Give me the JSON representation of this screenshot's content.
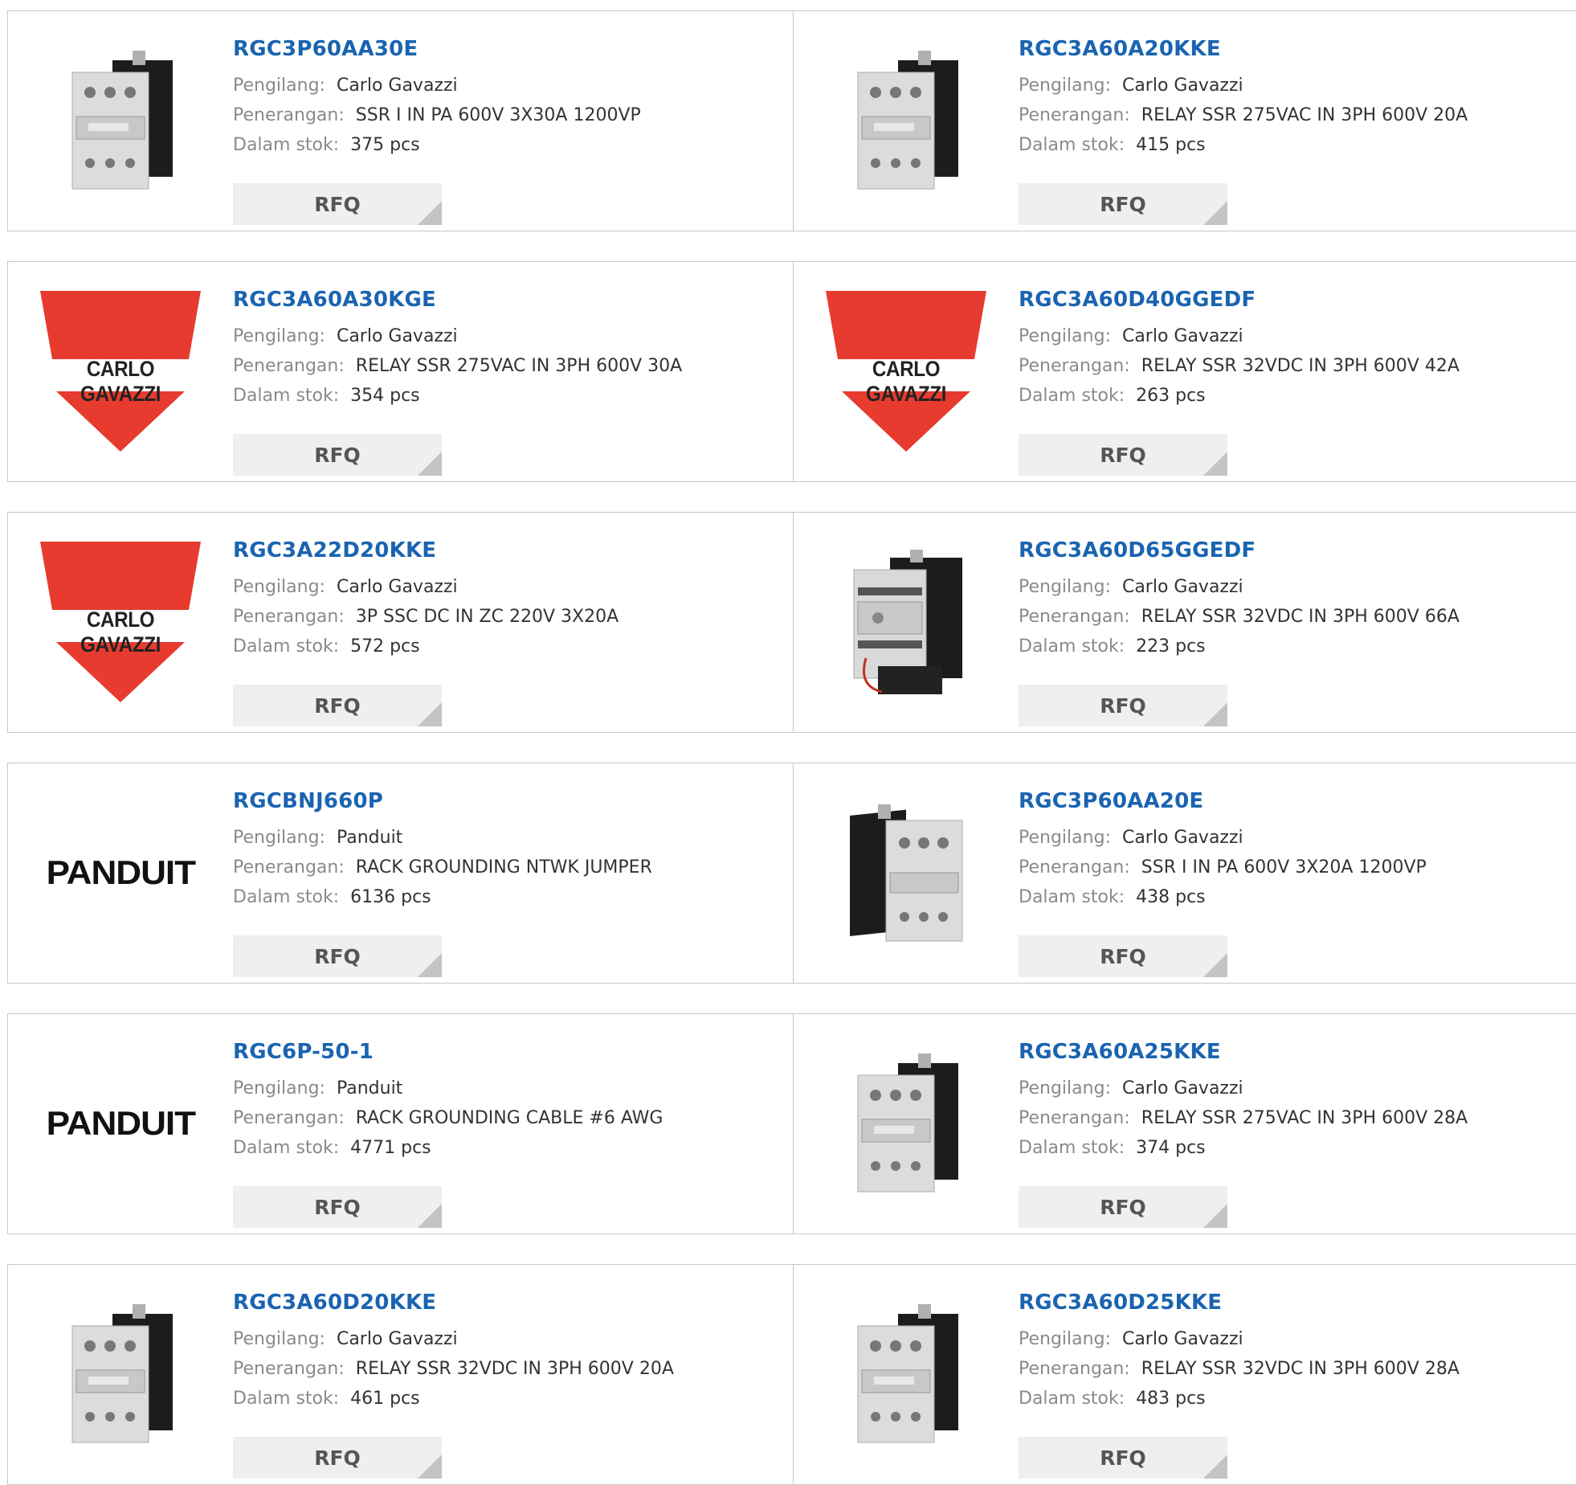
{
  "labels": {
    "manufacturer": "Pengilang:",
    "description": "Penerangan:",
    "stock": "Dalam stok:",
    "rfq": "RFQ"
  },
  "brand_logos": {
    "carlo": "CARLO GAVAZZI",
    "panduit": "PANDUIT"
  },
  "products": [
    {
      "part": "RGC3P60AA30E",
      "manufacturer": "Carlo Gavazzi",
      "description": "SSR I IN PA 600V 3X30A 1200VP",
      "stock": "375 pcs",
      "image": "relay-photo"
    },
    {
      "part": "RGC3A60A20KKE",
      "manufacturer": "Carlo Gavazzi",
      "description": "RELAY SSR 275VAC IN 3PH 600V 20A",
      "stock": "415 pcs",
      "image": "relay-photo"
    },
    {
      "part": "RGC3A60A30KGE",
      "manufacturer": "Carlo Gavazzi",
      "description": "RELAY SSR 275VAC IN 3PH 600V 30A",
      "stock": "354 pcs",
      "image": "carlo-gavazzi-logo"
    },
    {
      "part": "RGC3A60D40GGEDF",
      "manufacturer": "Carlo Gavazzi",
      "description": "RELAY SSR 32VDC IN 3PH 600V 42A",
      "stock": "263 pcs",
      "image": "carlo-gavazzi-logo"
    },
    {
      "part": "RGC3A22D20KKE",
      "manufacturer": "Carlo Gavazzi",
      "description": "3P SSC DC IN ZC 220V 3X20A",
      "stock": "572 pcs",
      "image": "carlo-gavazzi-logo"
    },
    {
      "part": "RGC3A60D65GGEDF",
      "manufacturer": "Carlo Gavazzi",
      "description": "RELAY SSR 32VDC IN 3PH 600V 66A",
      "stock": "223 pcs",
      "image": "relay-fan-photo"
    },
    {
      "part": "RGCBNJ660P",
      "manufacturer": "Panduit",
      "description": "RACK GROUNDING NTWK JUMPER",
      "stock": "6136 pcs",
      "image": "panduit-logo"
    },
    {
      "part": "RGC3P60AA20E",
      "manufacturer": "Carlo Gavazzi",
      "description": "SSR I IN PA 600V 3X20A 1200VP",
      "stock": "438 pcs",
      "image": "relay-photo-side"
    },
    {
      "part": "RGC6P-50-1",
      "manufacturer": "Panduit",
      "description": "RACK GROUNDING CABLE #6 AWG",
      "stock": "4771 pcs",
      "image": "panduit-logo"
    },
    {
      "part": "RGC3A60A25KKE",
      "manufacturer": "Carlo Gavazzi",
      "description": "RELAY SSR 275VAC IN 3PH 600V 28A",
      "stock": "374 pcs",
      "image": "relay-photo"
    },
    {
      "part": "RGC3A60D20KKE",
      "manufacturer": "Carlo Gavazzi",
      "description": "RELAY SSR 32VDC IN 3PH 600V 20A",
      "stock": "461 pcs",
      "image": "relay-photo"
    },
    {
      "part": "RGC3A60D25KKE",
      "manufacturer": "Carlo Gavazzi",
      "description": "RELAY SSR 32VDC IN 3PH 600V 28A",
      "stock": "483 pcs",
      "image": "relay-photo"
    }
  ],
  "colors": {
    "link": "#1a64b0",
    "logo_red": "#e63b2e",
    "label": "#8a8a8a",
    "value": "#333333",
    "rfq_bg": "#efefef",
    "border": "#c8c8c8"
  }
}
